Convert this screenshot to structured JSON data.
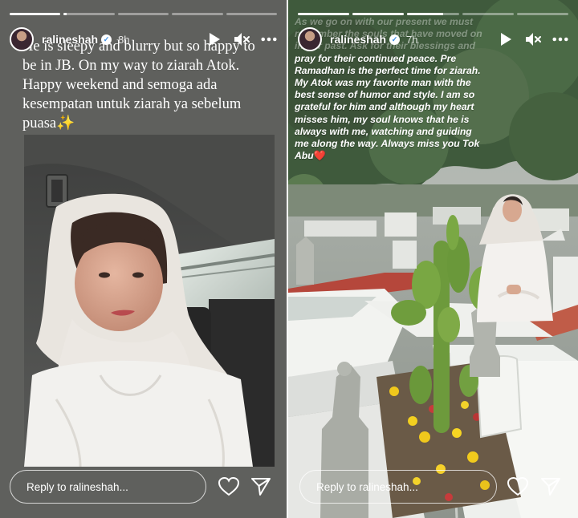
{
  "stories": [
    {
      "username": "ralineshah",
      "time": "8h",
      "progress": [
        1,
        0.05,
        0,
        0,
        0
      ],
      "caption_lines": [
        "He is sleepy and blurry but so happy to",
        "be in JB. On my way to ziarah Atok.",
        "Happy weekend and semoga ada",
        "kesempatan untuk ziarah ya sebelum",
        "puasa✨"
      ],
      "reply_placeholder": "Reply to ralineshah..."
    },
    {
      "username": "ralineshah",
      "time": "7h",
      "progress": [
        1,
        1,
        0.7,
        0,
        0
      ],
      "caption_faded_lines": [
        "As we go on with our present we must",
        "remember the souls that have moved on",
        "in our past. Ask for their blessings and"
      ],
      "caption_lines": [
        "pray for their continued peace. Pre",
        "Ramadhan is the perfect time for ziarah.",
        "My Atok was my favorite man with the",
        "best sense of humor and style. I am so",
        "grateful for him and although my heart",
        "misses him, my soul knows that he is",
        "always with me, watching and guiding",
        "me along the way. Always miss you Tok",
        "Abu"
      ],
      "caption_emoji": "❤️",
      "reply_placeholder": "Reply to ralineshah..."
    }
  ],
  "icons": {
    "play": "play-icon",
    "mute": "speaker-muted-icon",
    "more": "more-options-icon",
    "heart": "heart-icon",
    "send": "send-icon",
    "verified": "verified-badge-icon"
  },
  "colors": {
    "left_background": "#5f605d",
    "right_background": "#6f7a70",
    "text": "#ffffff",
    "verified": "#3a8ee6",
    "heart_emoji": "#e0242b"
  }
}
